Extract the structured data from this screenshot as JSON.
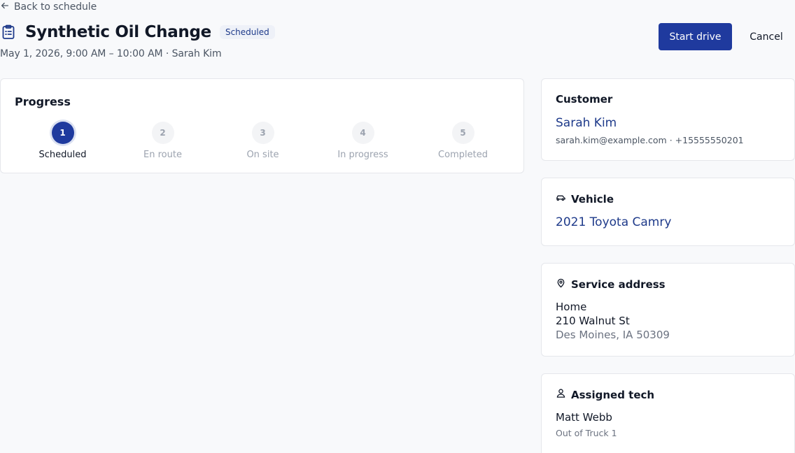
{
  "header": {
    "back_label": "Back to schedule",
    "title": "Synthetic Oil Change",
    "status_badge": "Scheduled",
    "subtitle": "May 1, 2026, 9:00 AM – 10:00 AM · Sarah Kim",
    "start_button": "Start drive",
    "cancel_button": "Cancel"
  },
  "progress": {
    "heading": "Progress",
    "current_step": 1,
    "steps": [
      {
        "number": "1",
        "label": "Scheduled"
      },
      {
        "number": "2",
        "label": "En route"
      },
      {
        "number": "3",
        "label": "On site"
      },
      {
        "number": "4",
        "label": "In progress"
      },
      {
        "number": "5",
        "label": "Completed"
      }
    ]
  },
  "customer": {
    "heading": "Customer",
    "name": "Sarah Kim",
    "contact": "sarah.kim@example.com · +15555550201"
  },
  "vehicle": {
    "heading": "Vehicle",
    "name": "2021 Toyota Camry"
  },
  "address": {
    "heading": "Service address",
    "label": "Home",
    "street": "210 Walnut St",
    "city": "Des Moines, IA 50309"
  },
  "tech": {
    "heading": "Assigned tech",
    "name": "Matt Webb",
    "detail": "Out of Truck 1"
  },
  "colors": {
    "primary": "#1f3a9e",
    "link": "#1e3a8a",
    "background": "#f8f9fb"
  }
}
